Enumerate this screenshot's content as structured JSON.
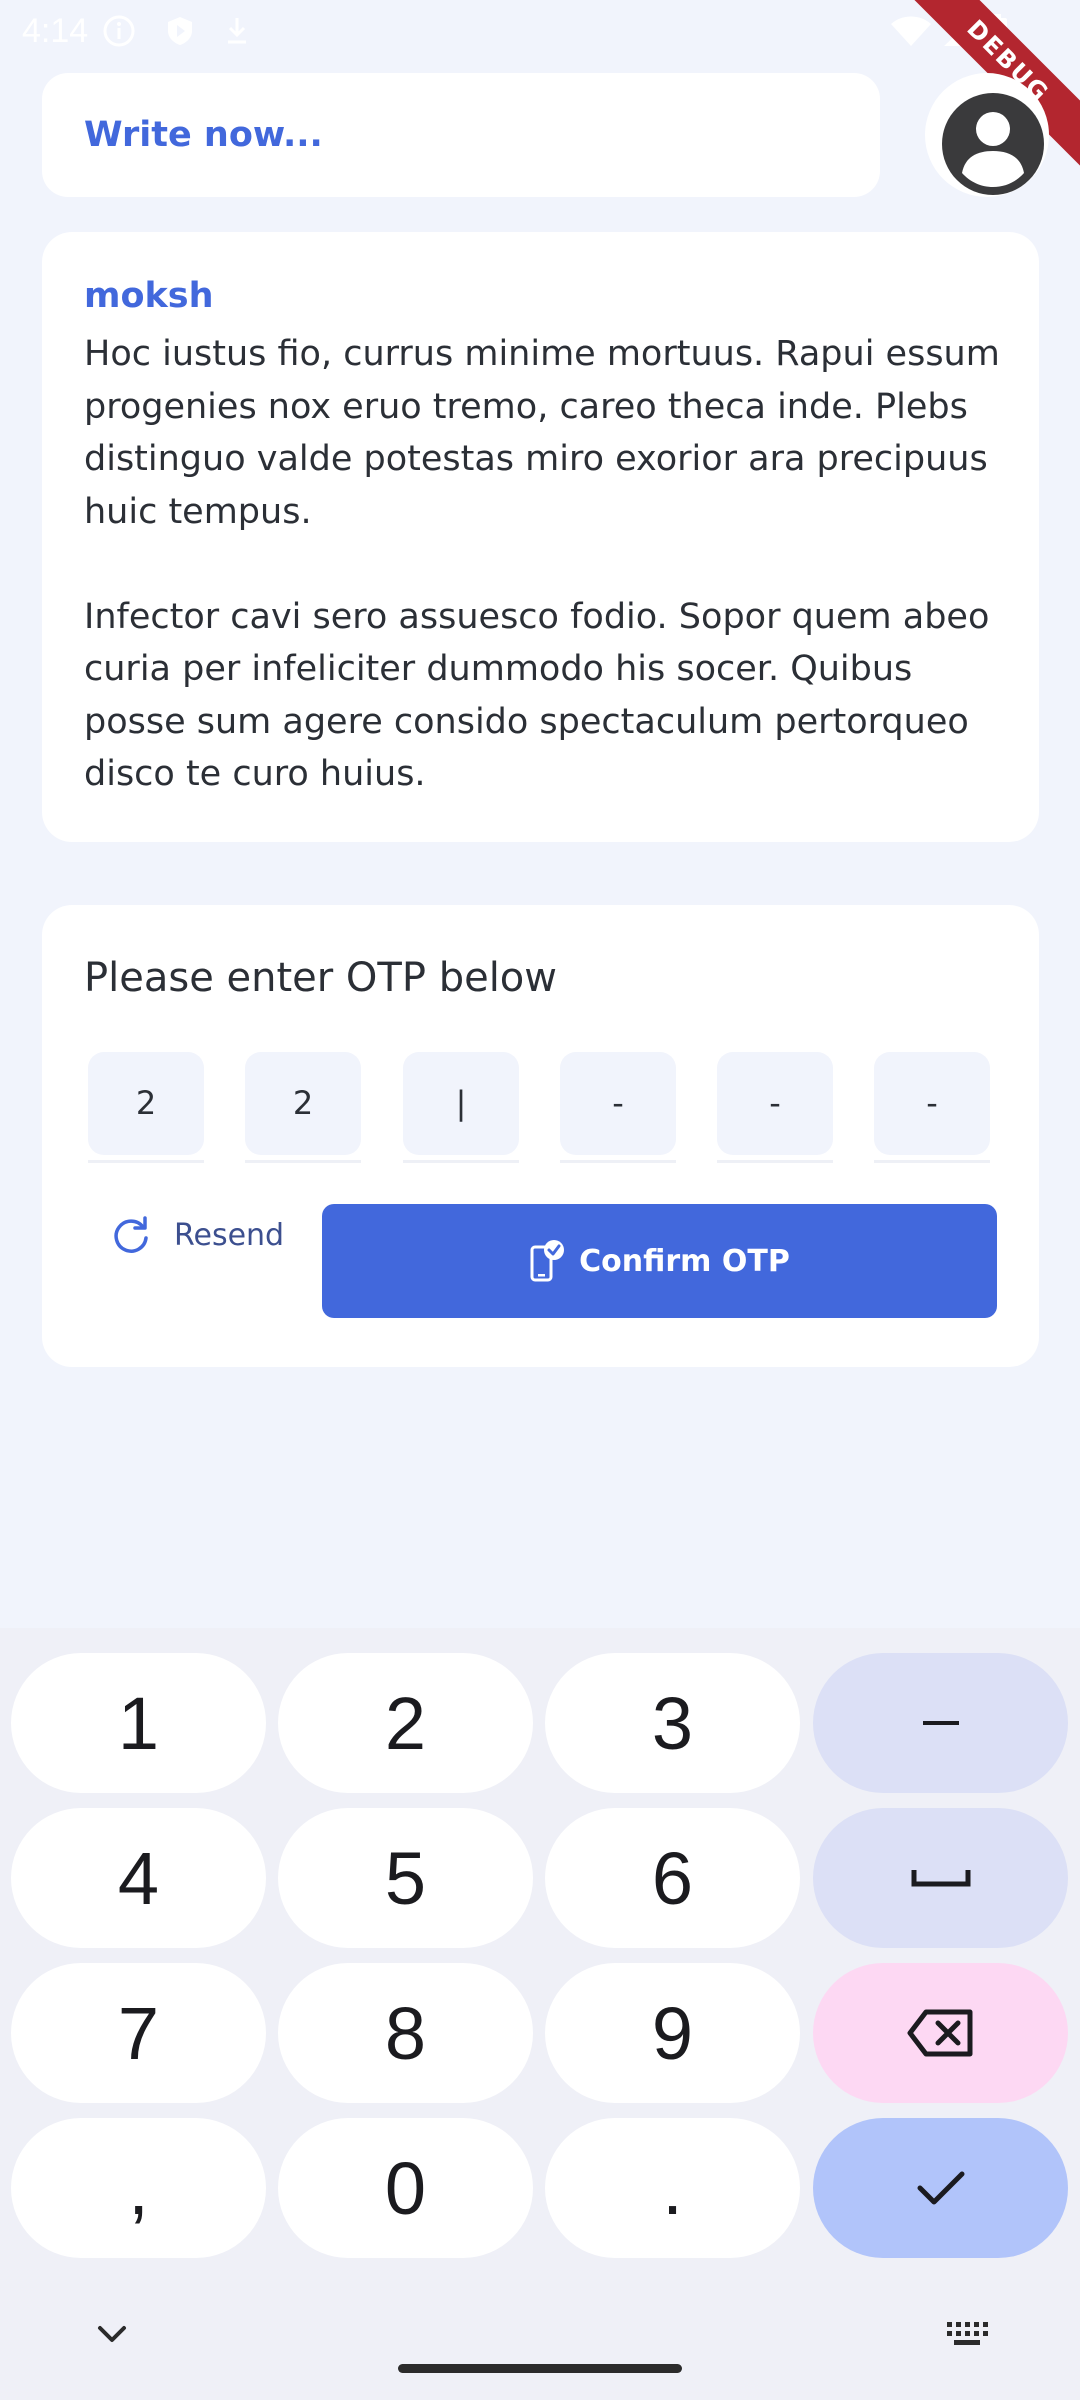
{
  "status_bar": {
    "time": "4:14"
  },
  "debug_banner": "DEBUG",
  "write_bar": {
    "label": "Write now..."
  },
  "post": {
    "author": "moksh",
    "body": "Hoc iustus fio, currus minime mortuus. Rapui essum progenies nox eruo tremo, careo theca inde. Plebs distinguo valde potestas miro exorior ara precipuus huic tempus.\n\nInfector cavi sero assuesco fodio. Sopor quem abeo curia per infeliciter dummodo his socer. Quibus posse sum agere consido spectaculum pertorqueo disco te curo huius."
  },
  "otp": {
    "title": "Please enter OTP below",
    "digits": [
      "2",
      "2",
      "|",
      "-",
      "-",
      "-"
    ],
    "resend_label": "Resend",
    "confirm_label": "Confirm OTP"
  },
  "keyboard": {
    "keys": [
      "1",
      "2",
      "3",
      "–",
      "4",
      "5",
      "6",
      "␣",
      "7",
      "8",
      "9",
      "⌫",
      ",",
      "0",
      ".",
      "✓"
    ]
  },
  "colors": {
    "accent": "#4268dc",
    "background": "#f1f4fc",
    "card": "#ffffff",
    "debug": "#b3262f"
  }
}
